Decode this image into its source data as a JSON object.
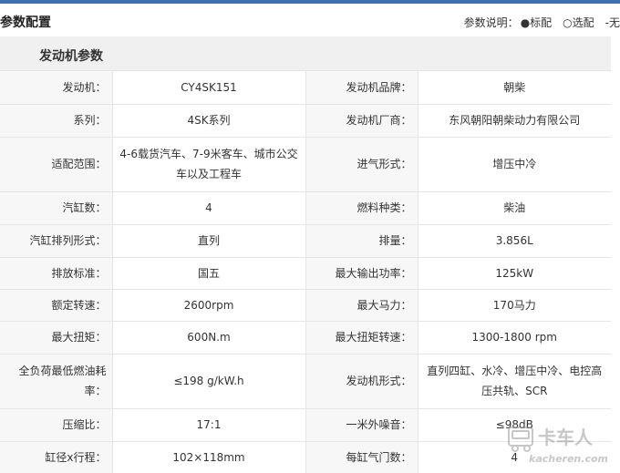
{
  "header": {
    "title": "参数配置",
    "legend_label": "参数说明：",
    "legend_standard": "●标配",
    "legend_optional": "○选配",
    "legend_none": "-无"
  },
  "section": {
    "title": "发动机参数"
  },
  "rows": [
    {
      "l1": "发动机：",
      "v1": "CY4SK151",
      "l2": "发动机品牌：",
      "v2": "朝柴"
    },
    {
      "l1": "系列：",
      "v1": "4SK系列",
      "l2": "发动机厂商：",
      "v2": "东风朝阳朝柴动力有限公司"
    },
    {
      "l1": "适配范围：",
      "v1": "4-6载货汽车、7-9米客车、城市公交车以及工程车",
      "l2": "进气形式：",
      "v2": "增压中冷"
    },
    {
      "l1": "汽缸数：",
      "v1": "4",
      "l2": "燃料种类：",
      "v2": "柴油"
    },
    {
      "l1": "汽缸排列形式：",
      "v1": "直列",
      "l2": "排量：",
      "v2": "3.856L"
    },
    {
      "l1": "排放标准：",
      "v1": "国五",
      "l2": "最大输出功率：",
      "v2": "125kW"
    },
    {
      "l1": "额定转速：",
      "v1": "2600rpm",
      "l2": "最大马力：",
      "v2": "170马力"
    },
    {
      "l1": "最大扭矩：",
      "v1": "600N.m",
      "l2": "最大扭矩转速：",
      "v2": "1300-1800 rpm"
    },
    {
      "l1": "全负荷最低燃油耗率：",
      "v1": "≤198 g/kW.h",
      "l2": "发动机形式：",
      "v2": "直列四缸、水冷、增压中冷、电控高压共轨、SCR"
    },
    {
      "l1": "压缩比：",
      "v1": "17:1",
      "l2": "一米外噪音：",
      "v2": "≤98dB"
    },
    {
      "l1": "缸径x行程：",
      "v1": "102×118mm",
      "l2": "每缸气门数：",
      "v2": "4"
    }
  ],
  "watermark": {
    "text": "卡车人",
    "domain": "kacheren.com"
  },
  "colors": {
    "accent": "#3e6fb0",
    "label_bg": "#f7f7f7",
    "section_bg": "#f0f0f0",
    "border": "#e6e6e6"
  }
}
